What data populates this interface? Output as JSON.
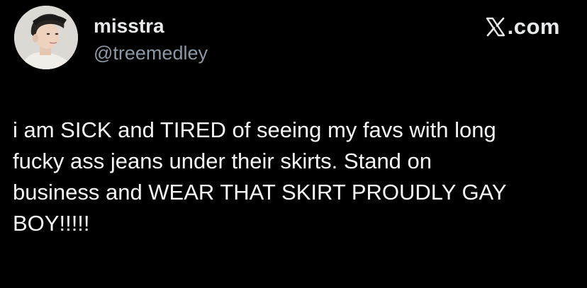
{
  "author": {
    "display_name": "misstra",
    "handle": "@treemedley",
    "avatar_icon": "profile-photo"
  },
  "brand": {
    "logo_icon": "x-logo-icon",
    "text": ".com"
  },
  "tweet": {
    "lines": [
      "i am SICK and TIRED of seeing my favs with long",
      "fucky ass jeans under their skirts. Stand on",
      "business and WEAR THAT SKIRT PROUDLY GAY",
      "BOY!!!!!"
    ]
  },
  "colors": {
    "background": "#000000",
    "primary_text": "#e7e9ea",
    "secondary_text": "#8b98a5"
  }
}
